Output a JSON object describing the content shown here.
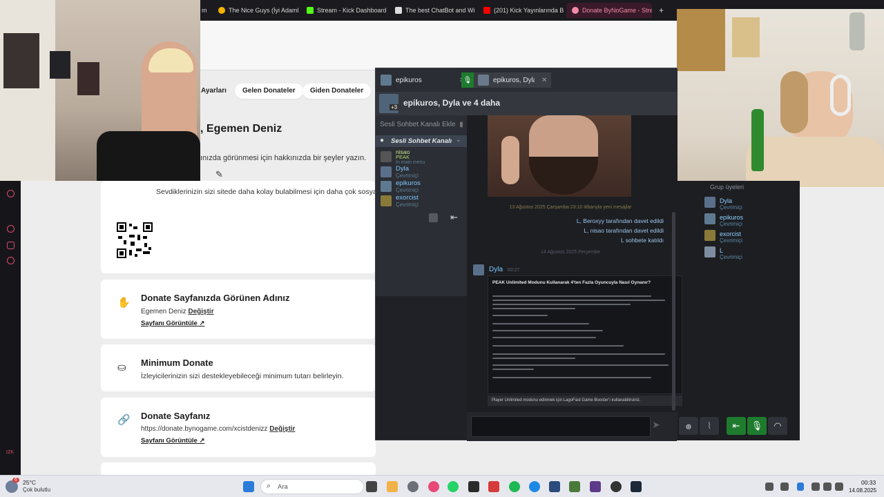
{
  "browser": {
    "tabs": [
      {
        "label": "m",
        "icon": "tab-icon",
        "color": "#8888ff"
      },
      {
        "label": "The Nice Guys (İyi Adamla",
        "icon": "circle-icon",
        "color": "#f4b400"
      },
      {
        "label": "Stream - Kick Dashboard",
        "icon": "kick-icon",
        "color": "#53fc18"
      },
      {
        "label": "The best ChatBot and Wi",
        "icon": "shield-icon",
        "color": "#dddddd"
      },
      {
        "label": "(201) Kick Yayınlarında B",
        "icon": "youtube-icon",
        "color": "#ff0000"
      },
      {
        "label": "Donate ByNoGame - Strea",
        "icon": "bynogame-icon",
        "color": "#f08aa6"
      }
    ],
    "new_tab": "+"
  },
  "profile_tabs": [
    "Ayarları",
    "Gelen Donateler",
    "Giden Donateler"
  ],
  "profile": {
    "name": ", Egemen Deniz",
    "hint": "ınızda görünmesi için hakkınızda bir şeyler yazın.",
    "social_hint": "Sevdiklerinizin sizi sitede daha kolay bulabilmesi için daha çok sosya"
  },
  "cards": [
    {
      "title": "Donate Sayfanızda Görünen Adınız",
      "text": "Egemen Deniz",
      "action": "Değiştir",
      "link": "Sayfanı Görüntüle"
    },
    {
      "title": "Minimum Donate",
      "text": "İzleyicilerinizin sizi destekleyebileceği minimum tutarı belirleyin."
    },
    {
      "title": "Donate Sayfanız",
      "text": "https://donate.bynogame.com/xcistdenizz",
      "action": "Değiştir",
      "link": "Sayfanı Görüntüle"
    }
  ],
  "sidebar_label": "IZK",
  "steam": {
    "tabs": [
      {
        "label": "epikuros"
      },
      {
        "label": "epikuros, Dyla"
      }
    ],
    "group_title": "epikuros, Dyla ve 4 daha",
    "group_avatar_count": "+3",
    "voice": {
      "add_label": "Sesli Sohbet Kanalı Ekle",
      "channel_label": "Sesli Sohbet Kanalı",
      "members": [
        {
          "name": "nisao",
          "status": "PEAK",
          "sub": "In main menu"
        },
        {
          "name": "Dyla",
          "status": "Çevrimiçi"
        },
        {
          "name": "epikuros",
          "status": "Çevrimiçi"
        },
        {
          "name": "exorcist",
          "status": "Çevrimiçi"
        }
      ]
    },
    "divider1": "13 Ağustos 2025 Çarşamba 23:10 itibarıyla yeni mesajlar",
    "system": [
      "L, Beroxyy tarafından davet edildi",
      "L, nisao tarafından davet edildi",
      "L sohbete katıldı"
    ],
    "divider2": "14 Ağustos 2025 Perşembe",
    "message": {
      "author": "Dyla",
      "time": "00:27",
      "title": "PEAK Unlimited Modunu Kullanarak 4'ten Fazla Oyuncuyla Nasıl Oynanır?",
      "footer": "Player Unlimited modunu edinmek için LagoFast Game Booster'ı kullanabilirsiniz."
    },
    "friends_header": "Grup üyeleri",
    "friends": [
      {
        "name": "Dyla",
        "status": "Çevrimiçi"
      },
      {
        "name": "epikuros",
        "status": "Çevrimiçi"
      },
      {
        "name": "exorcist",
        "status": "Çevrimiçi"
      },
      {
        "name": "L",
        "status": "Çevrimiçi"
      }
    ]
  },
  "taskbar": {
    "weather_temp": "25°C",
    "weather_desc": "Çok bulutlu",
    "weather_badge": "6",
    "search_label": "Ara",
    "time": "00:33",
    "date": "14.08.2025"
  },
  "colors": {
    "accent": "#e04a6d",
    "steam_bg": "#1f2126",
    "steam_link": "#7ec7ff",
    "voice_green": "#1e7b2e"
  }
}
